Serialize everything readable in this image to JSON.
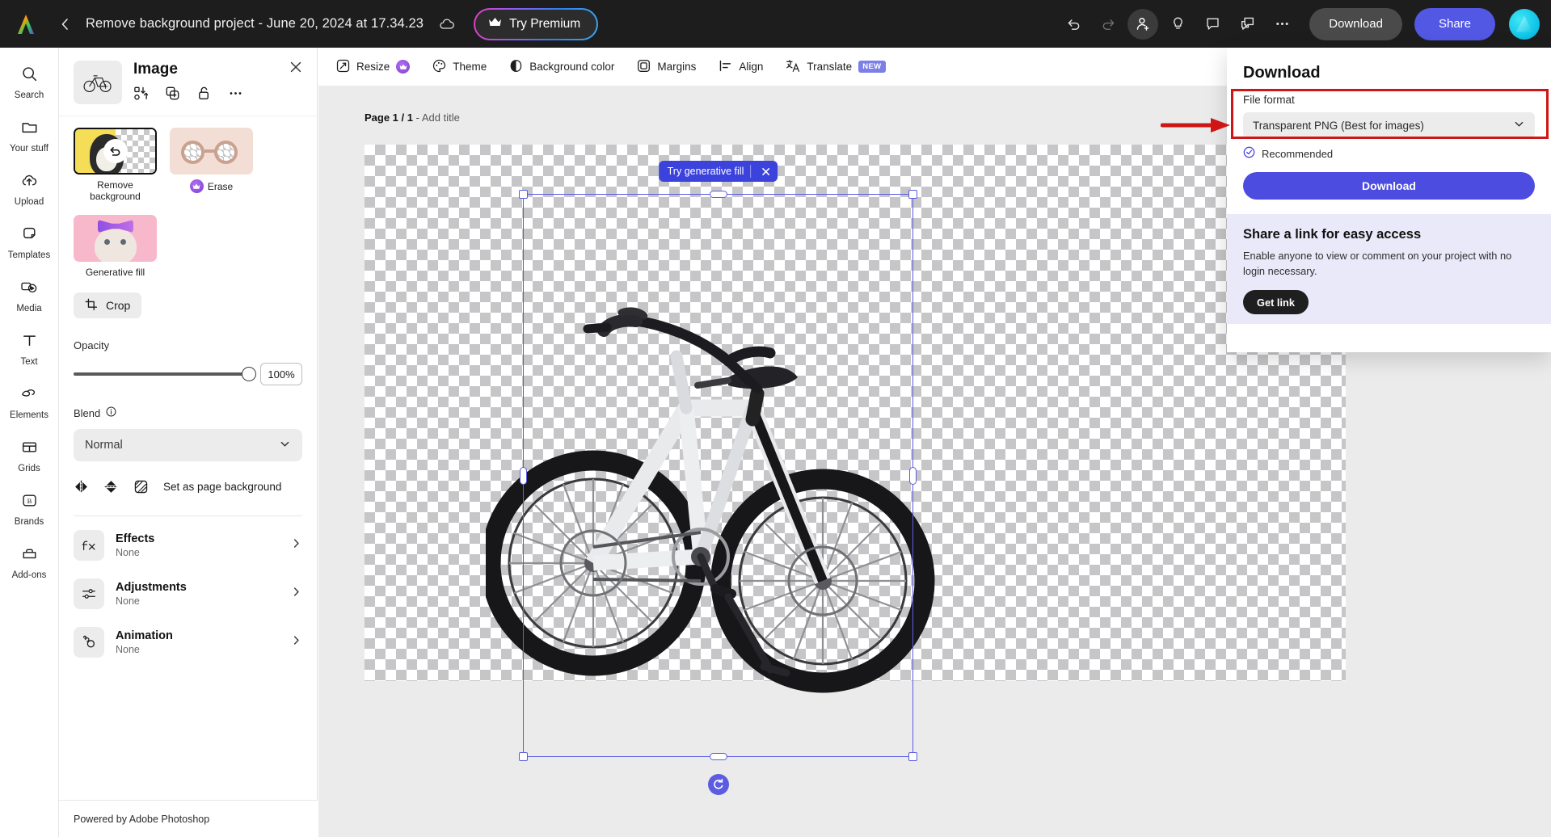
{
  "topbar": {
    "logo": "adobe-express-logo",
    "back_label": "back-chevron",
    "doc_title": "Remove background project - June 20, 2024 at 17.34.23",
    "cloud_status": "cloud-saved-icon",
    "try_premium": "Try Premium",
    "icons": [
      {
        "name": "undo-icon",
        "state": "enabled"
      },
      {
        "name": "redo-icon",
        "state": "disabled"
      },
      {
        "name": "invite-user-icon",
        "state": "active"
      },
      {
        "name": "tips-bulb-icon",
        "state": "enabled"
      },
      {
        "name": "comment-icon",
        "state": "enabled"
      },
      {
        "name": "duplicate-window-icon",
        "state": "enabled"
      },
      {
        "name": "more-options-icon",
        "state": "enabled"
      }
    ],
    "download_label": "Download",
    "share_label": "Share",
    "avatar": "user-avatar"
  },
  "rail": {
    "items": [
      {
        "icon": "search-icon",
        "label": "Search"
      },
      {
        "icon": "folder-icon",
        "label": "Your stuff"
      },
      {
        "icon": "upload-cloud-icon",
        "label": "Upload"
      },
      {
        "icon": "templates-icon",
        "label": "Templates"
      },
      {
        "icon": "media-icon",
        "label": "Media"
      },
      {
        "icon": "text-icon",
        "label": "Text"
      },
      {
        "icon": "elements-icon",
        "label": "Elements"
      },
      {
        "icon": "grids-icon",
        "label": "Grids"
      },
      {
        "icon": "brands-icon",
        "label": "Brands"
      },
      {
        "icon": "addons-icon",
        "label": "Add-ons"
      }
    ]
  },
  "panel": {
    "title": "Image",
    "close": "close-icon",
    "head_icons": [
      {
        "name": "replace-media-icon"
      },
      {
        "name": "duplicate-icon"
      },
      {
        "name": "unlock-icon"
      },
      {
        "name": "more-icon"
      }
    ],
    "cards": [
      {
        "name": "remove-background",
        "label": "Remove background",
        "premium": false,
        "selected": true
      },
      {
        "name": "erase",
        "label": "Erase",
        "premium": true,
        "selected": false
      },
      {
        "name": "generative-fill",
        "label": "Generative fill",
        "premium": false,
        "selected": false
      }
    ],
    "crop_label": "Crop",
    "opacity_label": "Opacity",
    "opacity_value": "100%",
    "opacity_percent": 100,
    "blend_label": "Blend",
    "blend_value": "Normal",
    "flip_icons": [
      {
        "name": "flip-horizontal-icon"
      },
      {
        "name": "flip-vertical-icon"
      }
    ],
    "set_bg_label": "Set as page background",
    "rows": [
      {
        "icon": "fx-icon",
        "title": "Effects",
        "sub": "None"
      },
      {
        "icon": "adjustments-icon",
        "title": "Adjustments",
        "sub": "None"
      },
      {
        "icon": "animation-icon",
        "title": "Animation",
        "sub": "None"
      }
    ],
    "footer": "Powered by Adobe Photoshop"
  },
  "canvas_toolbar": {
    "items": [
      {
        "icon": "resize-icon",
        "label": "Resize",
        "premium": true
      },
      {
        "icon": "theme-icon",
        "label": "Theme",
        "premium": false
      },
      {
        "icon": "background-color-icon",
        "label": "Background color",
        "premium": false
      },
      {
        "icon": "margins-icon",
        "label": "Margins",
        "premium": false
      },
      {
        "icon": "align-icon",
        "label": "Align",
        "premium": false
      },
      {
        "icon": "translate-icon",
        "label": "Translate",
        "premium": false,
        "badge": "NEW"
      }
    ]
  },
  "canvas": {
    "page_prefix": "Page 1 / 1",
    "page_sep": "-",
    "add_title": "Add title",
    "genfill_label": "Try generative fill",
    "genfill_close": "close-icon",
    "rotate_handle": "rotate-icon",
    "selected_object": "bicycle-image"
  },
  "download_panel": {
    "title": "Download",
    "file_format_label": "File format",
    "file_format_value": "Transparent PNG (Best for images)",
    "recommended_label": "Recommended",
    "download_button": "Download",
    "share_title": "Share a link for easy access",
    "share_desc": "Enable anyone to view or comment on your project with no login necessary.",
    "get_link_label": "Get link"
  },
  "annotation": {
    "highlight_color": "#cf1616",
    "arrow": "red-arrow-pointing-right",
    "target": "file-format-dropdown"
  }
}
